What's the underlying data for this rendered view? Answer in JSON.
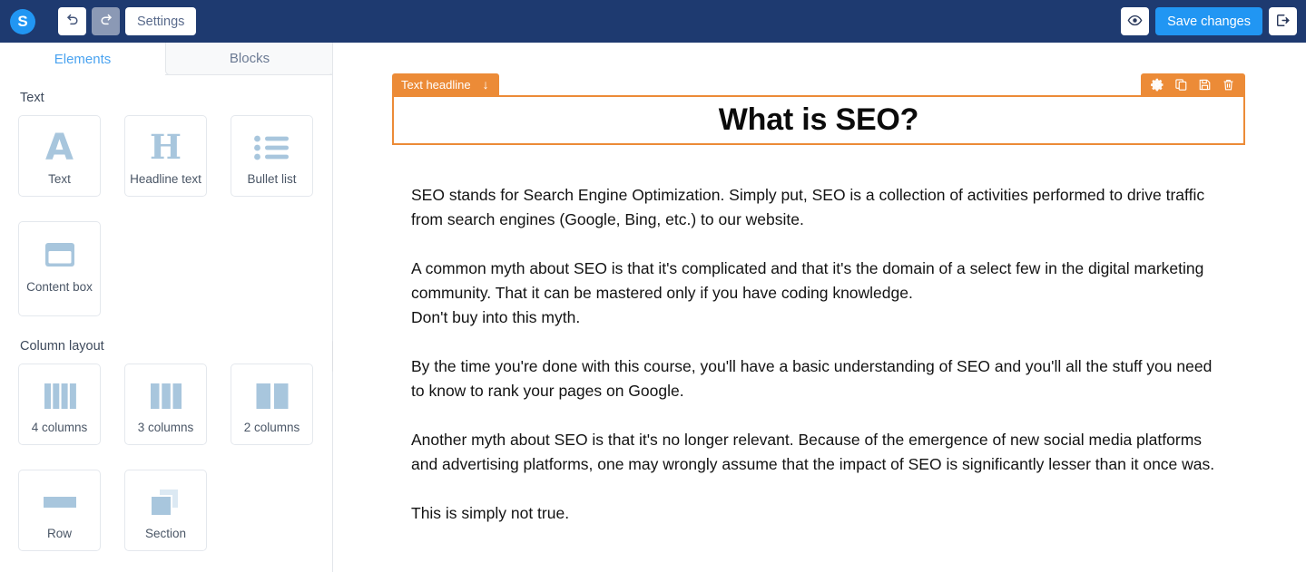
{
  "topbar": {
    "logo_letter": "S",
    "undo_icon": "undo-arrow-icon",
    "redo_icon": "redo-arrow-icon",
    "settings_label": "Settings",
    "preview_icon": "eye-icon",
    "save_label": "Save changes",
    "exit_icon": "exit-arrow-icon",
    "bg_color": "#1e3a70",
    "accent_color": "#2196f3"
  },
  "sidebar": {
    "tabs": [
      {
        "label": "Elements",
        "active": true
      },
      {
        "label": "Blocks",
        "active": false
      }
    ],
    "groups": [
      {
        "title": "Text",
        "cards": [
          {
            "label": "Text",
            "icon": "letter-a-icon"
          },
          {
            "label": "Headline text",
            "icon": "letter-h-icon"
          },
          {
            "label": "Bullet list",
            "icon": "bullet-list-icon"
          },
          {
            "label": "Content box",
            "icon": "content-box-icon"
          }
        ]
      },
      {
        "title": "Column layout",
        "cards": [
          {
            "label": "4 columns",
            "icon": "four-columns-icon"
          },
          {
            "label": "3 columns",
            "icon": "three-columns-icon"
          },
          {
            "label": "2 columns",
            "icon": "two-columns-icon"
          },
          {
            "label": "Row",
            "icon": "row-icon"
          },
          {
            "label": "Section",
            "icon": "section-icon"
          }
        ]
      }
    ],
    "collapse_handle": "sidebar-collapse-handle"
  },
  "canvas": {
    "selected_block": {
      "label": "Text headline",
      "move_icon": "down-arrow-icon",
      "accent_color": "#ec8b37",
      "tools": [
        {
          "icon": "gear-icon"
        },
        {
          "icon": "duplicate-icon"
        },
        {
          "icon": "save-disk-icon"
        },
        {
          "icon": "trash-icon"
        }
      ]
    },
    "headline": "What is SEO?",
    "paragraphs": [
      "SEO stands for Search Engine Optimization. Simply put, SEO is a collection of activities performed to drive traffic from search engines (Google, Bing, etc.) to our website.",
      "A common myth about SEO is that it's complicated and that it's the domain of a select few in the digital marketing community. That it can be mastered only if you have coding knowledge.\nDon't buy into this myth.",
      "By the time you're done with this course, you'll have a basic understanding of SEO and you'll all the stuff you need to know to rank your pages on Google.",
      "Another myth about SEO is that it's no longer relevant. Because of the emergence of new social media platforms and advertising platforms, one may wrongly assume that the impact of SEO is significantly lesser than it once was.",
      "This is simply not true."
    ]
  }
}
